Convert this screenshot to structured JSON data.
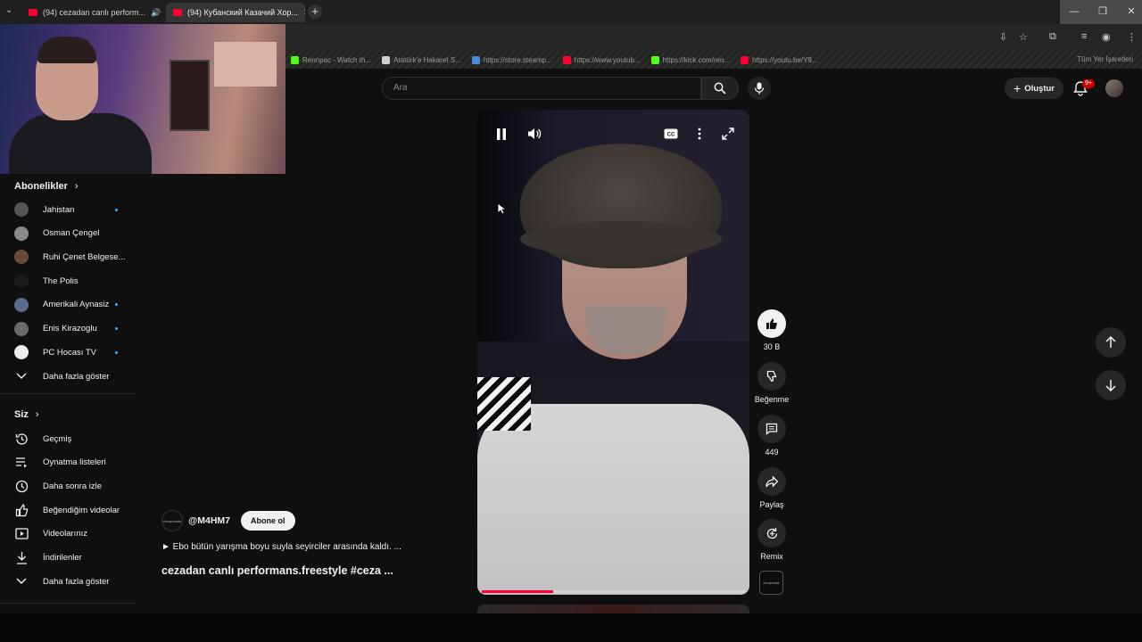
{
  "browser": {
    "tabs": [
      {
        "title": "(94) cezadan canlı perform...",
        "muted_icon": "speaker-icon"
      },
      {
        "title": "(94) Кубанский Казачий Хор..."
      }
    ],
    "bookmarks": [
      {
        "label": "Rennpac - Watch th...",
        "color": "#53fc18"
      },
      {
        "label": "Atatürk'e Hakaret S...",
        "color": "#cfcfcf"
      },
      {
        "label": "https://store.steamp...",
        "color": "#4a8ad8"
      },
      {
        "label": "https://www.youtub...",
        "color": "#ff0033"
      },
      {
        "label": "https://kick.com/ren...",
        "color": "#53fc18"
      },
      {
        "label": "https://youtu.be/Y9...",
        "color": "#ff0033"
      }
    ],
    "all_bookmarks": "Tüm Yer İşaretleri"
  },
  "header": {
    "search_placeholder": "Ara",
    "create_label": "Oluştur",
    "notifications_badge": "9+"
  },
  "sidebar": {
    "subscriptions_title": "Abonelikler",
    "subscriptions": [
      {
        "label": "Jahistan",
        "new": true,
        "avatar_color": "#555555"
      },
      {
        "label": "Osman Çengel",
        "new": false,
        "avatar_color": "#8a8a8a"
      },
      {
        "label": "Ruhi Çenet Belgese...",
        "new": false,
        "avatar_color": "#6a4a3a"
      },
      {
        "label": "The Polis",
        "new": false,
        "avatar_color": "#1a1a1a"
      },
      {
        "label": "Amerikali Aynasiz",
        "new": true,
        "avatar_color": "#5a6a8a"
      },
      {
        "label": "Enis Kirazoglu",
        "new": true,
        "avatar_color": "#6a6a6a"
      },
      {
        "label": "PC Hocası TV",
        "new": true,
        "avatar_color": "#eeeeee"
      }
    ],
    "show_more_1": "Daha fazla göster",
    "you_title": "Siz",
    "you_items": [
      {
        "label": "Geçmiş",
        "icon": "history-icon"
      },
      {
        "label": "Oynatma listeleri",
        "icon": "playlists-icon"
      },
      {
        "label": "Daha sonra izle",
        "icon": "watch-later-icon"
      },
      {
        "label": "Beğendiğim videolar",
        "icon": "liked-videos-icon"
      },
      {
        "label": "Videolarınız",
        "icon": "your-videos-icon"
      },
      {
        "label": "İndirilenler",
        "icon": "downloads-icon"
      }
    ],
    "show_more_2": "Daha fazla göster"
  },
  "short": {
    "channel": "@M4HM7",
    "channel_avatar_text": "ctrcapmade",
    "subscribe_label": "Abone ol",
    "description": "► Ebo bütün yarışma boyu suyla seyirciler arasında kaldı. ...",
    "title": "cezadan canlı performans.freestyle #ceza ...",
    "progress": 0.27,
    "likes": "30 B",
    "dislike_label": "Beğenme",
    "comments": "449",
    "share_label": "Paylaş",
    "remix_label": "Remix",
    "sound_thumb_text": "ctrcapmade"
  },
  "colors": {
    "accent_red": "#ff0033",
    "new_dot": "#3ea6ff",
    "background": "#0f0f0f"
  }
}
